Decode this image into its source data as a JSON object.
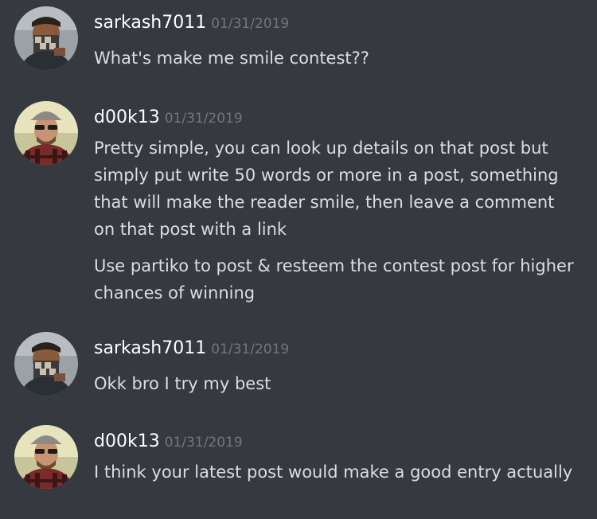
{
  "messages": [
    {
      "username": "sarkash7011",
      "timestamp": "01/31/2019",
      "avatar_icon": "masked-user-avatar-icon",
      "paragraphs": [
        "What's make me smile contest??"
      ]
    },
    {
      "username": "d00k13",
      "timestamp": "01/31/2019",
      "avatar_icon": "cap-sunglasses-user-avatar-icon",
      "paragraphs": [
        "Pretty simple, you can look up details on that post but simply put write 50 words or more in a post, something that will make the reader smile, then leave a comment on that post with a link",
        "Use partiko to post & resteem the contest post for higher chances of winning"
      ]
    },
    {
      "username": "sarkash7011",
      "timestamp": "01/31/2019",
      "avatar_icon": "masked-user-avatar-icon",
      "paragraphs": [
        "Okk bro I try my best"
      ]
    },
    {
      "username": "d00k13",
      "timestamp": "01/31/2019",
      "avatar_icon": "cap-sunglasses-user-avatar-icon",
      "paragraphs": [
        "I think your latest post would make a good entry actually"
      ]
    }
  ],
  "colors": {
    "background": "#36393f",
    "username": "#ffffff",
    "timestamp": "#72767d",
    "message_text": "#dcddde"
  }
}
